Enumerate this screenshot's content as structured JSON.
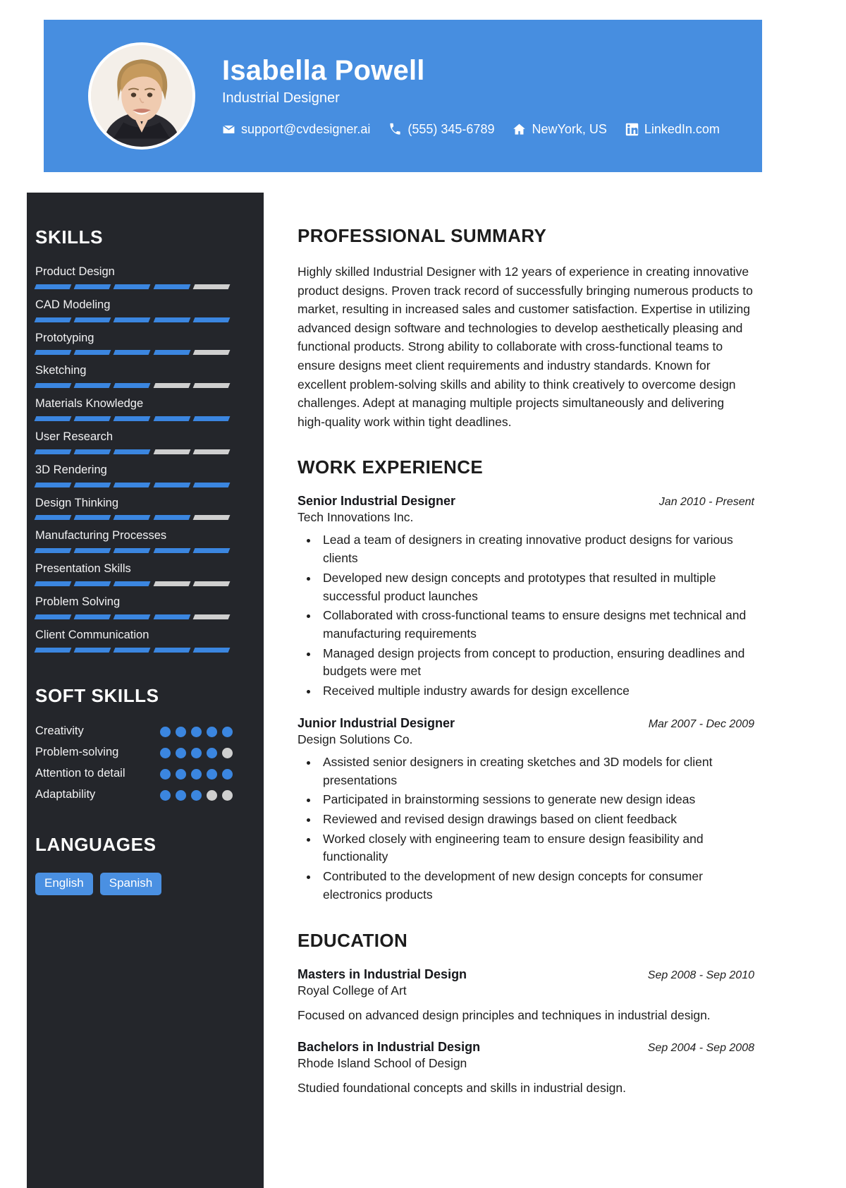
{
  "colors": {
    "accent": "#478ee0",
    "sidebar_bg": "#24262b",
    "bar_on": "#3b86e0",
    "bar_off": "#cfcfcf",
    "page_bg": "#ffffff"
  },
  "header": {
    "name": "Isabella Powell",
    "role": "Industrial Designer",
    "avatar_icon": "portrait-photo",
    "contacts": [
      {
        "icon": "email-icon",
        "text": "support@cvdesigner.ai"
      },
      {
        "icon": "phone-icon",
        "text": "(555) 345-6789"
      },
      {
        "icon": "home-icon",
        "text": "NewYork, US"
      },
      {
        "icon": "linkedin-icon",
        "text": "LinkedIn.com"
      }
    ]
  },
  "sidebar": {
    "skills_heading": "SKILLS",
    "skills_max": 5,
    "skills": [
      {
        "name": "Product Design",
        "level": 4
      },
      {
        "name": "CAD Modeling",
        "level": 5
      },
      {
        "name": "Prototyping",
        "level": 4
      },
      {
        "name": "Sketching",
        "level": 3
      },
      {
        "name": "Materials Knowledge",
        "level": 5
      },
      {
        "name": "User Research",
        "level": 3
      },
      {
        "name": "3D Rendering",
        "level": 5
      },
      {
        "name": "Design Thinking",
        "level": 4
      },
      {
        "name": "Manufacturing Processes",
        "level": 5
      },
      {
        "name": "Presentation Skills",
        "level": 3
      },
      {
        "name": "Problem Solving",
        "level": 4
      },
      {
        "name": "Client Communication",
        "level": 5
      }
    ],
    "soft_skills_heading": "SOFT SKILLS",
    "soft_skills_max": 5,
    "soft_skills": [
      {
        "name": "Creativity",
        "level": 5
      },
      {
        "name": "Problem-solving",
        "level": 4
      },
      {
        "name": "Attention to detail",
        "level": 5
      },
      {
        "name": "Adaptability",
        "level": 3
      }
    ],
    "languages_heading": "LANGUAGES",
    "languages": [
      "English",
      "Spanish"
    ]
  },
  "main": {
    "summary_heading": "PROFESSIONAL SUMMARY",
    "summary_text": "Highly skilled Industrial Designer with 12 years of experience in creating innovative product designs. Proven track record of successfully bringing numerous products to market, resulting in increased sales and customer satisfaction. Expertise in utilizing advanced design software and technologies to develop aesthetically pleasing and functional products. Strong ability to collaborate with cross-functional teams to ensure designs meet client requirements and industry standards. Known for excellent problem-solving skills and ability to think creatively to overcome design challenges. Adept at managing multiple projects simultaneously and delivering high-quality work within tight deadlines.",
    "work_heading": "WORK EXPERIENCE",
    "work": [
      {
        "title": "Senior Industrial Designer",
        "date": "Jan 2010 - Present",
        "org": "Tech Innovations Inc.",
        "bullets": [
          "Lead a team of designers in creating innovative product designs for various clients",
          "Developed new design concepts and prototypes that resulted in multiple successful product launches",
          "Collaborated with cross-functional teams to ensure designs met technical and manufacturing requirements",
          "Managed design projects from concept to production, ensuring deadlines and budgets were met",
          "Received multiple industry awards for design excellence"
        ]
      },
      {
        "title": "Junior Industrial Designer",
        "date": "Mar 2007 - Dec 2009",
        "org": "Design Solutions Co.",
        "bullets": [
          "Assisted senior designers in creating sketches and 3D models for client presentations",
          "Participated in brainstorming sessions to generate new design ideas",
          "Reviewed and revised design drawings based on client feedback",
          "Worked closely with engineering team to ensure design feasibility and functionality",
          "Contributed to the development of new design concepts for consumer electronics products"
        ]
      }
    ],
    "education_heading": "EDUCATION",
    "education": [
      {
        "degree": "Masters in Industrial Design",
        "date": "Sep 2008 - Sep 2010",
        "school": "Royal College of Art",
        "description": "Focused on advanced design principles and techniques in industrial design."
      },
      {
        "degree": "Bachelors in Industrial Design",
        "date": "Sep 2004 - Sep 2008",
        "school": "Rhode Island School of Design",
        "description": "Studied foundational concepts and skills in industrial design."
      }
    ]
  }
}
